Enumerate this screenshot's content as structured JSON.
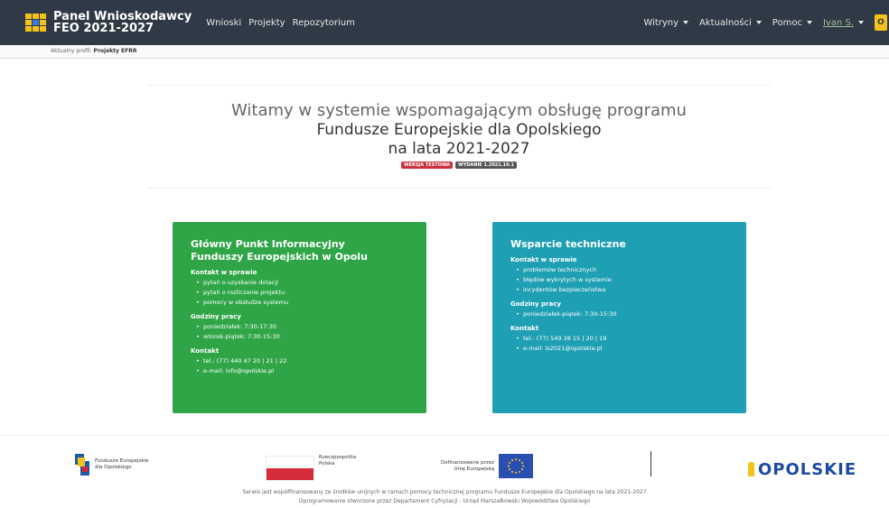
{
  "header": {
    "brand_line1": "Panel Wnioskodawcy",
    "brand_line2": "FEO 2021-2027",
    "nav_left": [
      "Wnioski",
      "Projekty",
      "Repozytorium"
    ],
    "nav_right": [
      "Witryny",
      "Aktualności",
      "Pomoc"
    ],
    "user_label": "Ivan S.",
    "yellow_button_glyph": "O"
  },
  "profile_bar": {
    "label": "Aktualny profil:",
    "value": "Projekty EFRR"
  },
  "welcome": {
    "line1": "Witamy w systemie wspomagającym obsługę programu",
    "line2": "Fundusze Europejskie dla Opolskiego",
    "line3": "na lata 2021-2027",
    "badge_test": "WERSJA TESTOWA",
    "badge_version": "WYDANIE 1.2021.10.1"
  },
  "card_green": {
    "title_line1": "Główny Punkt Informacyjny",
    "title_line2": "Funduszy Europejskich w Opolu",
    "contact_heading": "Kontakt w sprawie",
    "contact_items": [
      "pytań o uzyskanie dotacji",
      "pytań o rozliczanie projektu",
      "pomocy w obsłudze systemu"
    ],
    "hours_heading": "Godziny pracy",
    "hours_items": [
      "poniedziałek: 7:30-17:30",
      "wtorek-piątek: 7:30-15:30"
    ],
    "contact2_heading": "Kontakt",
    "contact2_items": [
      "tel.: (77) 440 47 20 | 21 | 22",
      "e-mail: info@opolskie.pl"
    ]
  },
  "card_teal": {
    "title": "Wsparcie techniczne",
    "contact_heading": "Kontakt w sprawie",
    "contact_items": [
      "problemów technicznych",
      "błędów wykrytych w systemie",
      "incydentów bezpieczeństwa"
    ],
    "hours_heading": "Godziny pracy",
    "hours_items": [
      "poniedziałek-piątek: 7:30-15:30"
    ],
    "contact2_heading": "Kontakt",
    "contact2_items": [
      "tel.: (77) 549 38 15 | 20 | 19",
      "e-mail: ls2021@opolskie.pl"
    ]
  },
  "footer_logos": {
    "fe_line1": "Fundusze Europejskie",
    "fe_line2": "dla Opolskiego",
    "rp_line1": "Rzeczpospolita",
    "rp_line2": "Polska",
    "eu_line1": "Dofinansowane przez",
    "eu_line2": "Unię Europejską",
    "opolskie": "OPOLSKIE"
  },
  "footer_text": {
    "line1": "Serwis jest współfinansowany ze środków unijnych w ramach pomocy technicznej programu Fundusze Europejskie dla Opolskiego na lata 2021-2027",
    "line2": "Oprogramowanie stworzone przez Departament Cyfryzacji - Urząd Marszałkowski Województwa Opolskiego"
  },
  "colors": {
    "navbar": "#2f3a46",
    "green_card": "#2fa548",
    "teal_card": "#1f9fb3",
    "badge_red": "#c9303c",
    "accent_yellow": "#f5c21b"
  }
}
